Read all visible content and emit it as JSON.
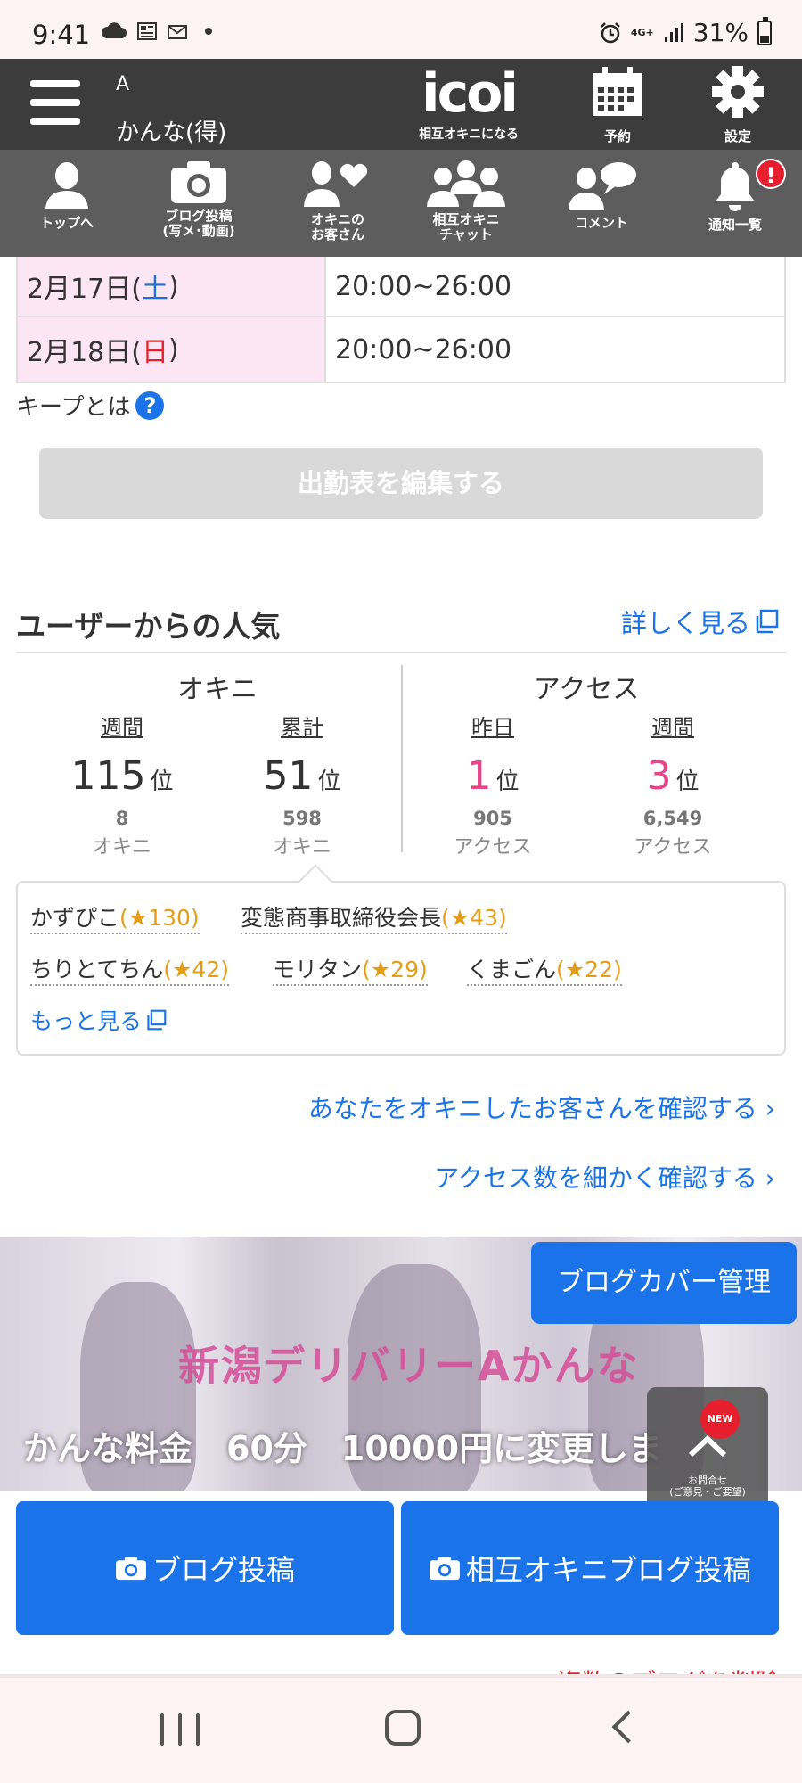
{
  "status_bar": {
    "time": "9:41",
    "network": "4G+",
    "battery": "31%"
  },
  "header": {
    "small_label": "A",
    "name": "かんな(得)",
    "logo": "icoi",
    "logo_sub": "相互オキニになる",
    "reserve_label": "予約",
    "settings_label": "設定"
  },
  "nav": {
    "items": [
      {
        "label": "トップへ",
        "icon": "person-icon"
      },
      {
        "label": "ブログ投稿\n(写メ･動画)",
        "icon": "camera-icon"
      },
      {
        "label": "オキニの\nお客さん",
        "icon": "person-heart-icon"
      },
      {
        "label": "相互オキニ\nチャット",
        "icon": "group-icon"
      },
      {
        "label": "コメント",
        "icon": "comment-icon"
      },
      {
        "label": "通知一覧",
        "icon": "bell-icon"
      }
    ],
    "notification_badge": "!"
  },
  "schedule": {
    "rows": [
      {
        "date_prefix": "2月17日(",
        "day": "土",
        "date_suffix": ")",
        "time": "20:00~26:00"
      },
      {
        "date_prefix": "2月18日(",
        "day": "日",
        "date_suffix": ")",
        "time": "20:00~26:00"
      }
    ],
    "keep_label": "キープとは",
    "help_mark": "?",
    "edit_button": "出勤表を編集する"
  },
  "popularity": {
    "title": "ユーザーからの人気",
    "more": "詳しく見る",
    "okini_label": "オキニ",
    "access_label": "アクセス",
    "columns": [
      {
        "title": "週間",
        "rank": "115",
        "unit": "位",
        "count": "8",
        "count_label": "オキニ"
      },
      {
        "title": "累計",
        "rank": "51",
        "unit": "位",
        "count": "598",
        "count_label": "オキニ"
      },
      {
        "title": "昨日",
        "rank": "1",
        "unit": "位",
        "count": "905",
        "count_label": "アクセス"
      },
      {
        "title": "週間",
        "rank": "3",
        "unit": "位",
        "count": "6,549",
        "count_label": "アクセス"
      }
    ]
  },
  "fans": {
    "items": [
      {
        "name": "かずぴこ",
        "stars": "(★130)"
      },
      {
        "name": "変態商事取締役会長",
        "stars": "(★43)"
      },
      {
        "name": "ちりとてちん",
        "stars": "(★42)"
      },
      {
        "name": "モリタン",
        "stars": "(★29)"
      },
      {
        "name": "くまごん",
        "stars": "(★22)"
      }
    ],
    "more": "もっと見る"
  },
  "links": {
    "check_okini": "あなたをオキニしたお客さんを確認する",
    "check_access": "アクセス数を細かく確認する"
  },
  "banner": {
    "title": "新潟デリバリーAかんな",
    "caption": "かんな料金　60分　10000円に変更しま",
    "cover_button": "ブログカバー管理",
    "fab_new": "NEW",
    "fab_sub": "お問合せ\n(ご意見・ご要望)"
  },
  "actions": {
    "blog_post": "ブログ投稿",
    "mutual_blog_post": "相互オキニブログ投稿",
    "delete_multiple": "複数のブログを削除"
  },
  "colors": {
    "header_bg": "#3c3c3c",
    "nav_bg": "#5d5d5d",
    "accent_blue": "#1a73e8",
    "rank_pink": "#e9448a",
    "saturday_blue": "#1f6fd6",
    "sunday_red": "#e0242e",
    "star_orange": "#e39d17"
  }
}
